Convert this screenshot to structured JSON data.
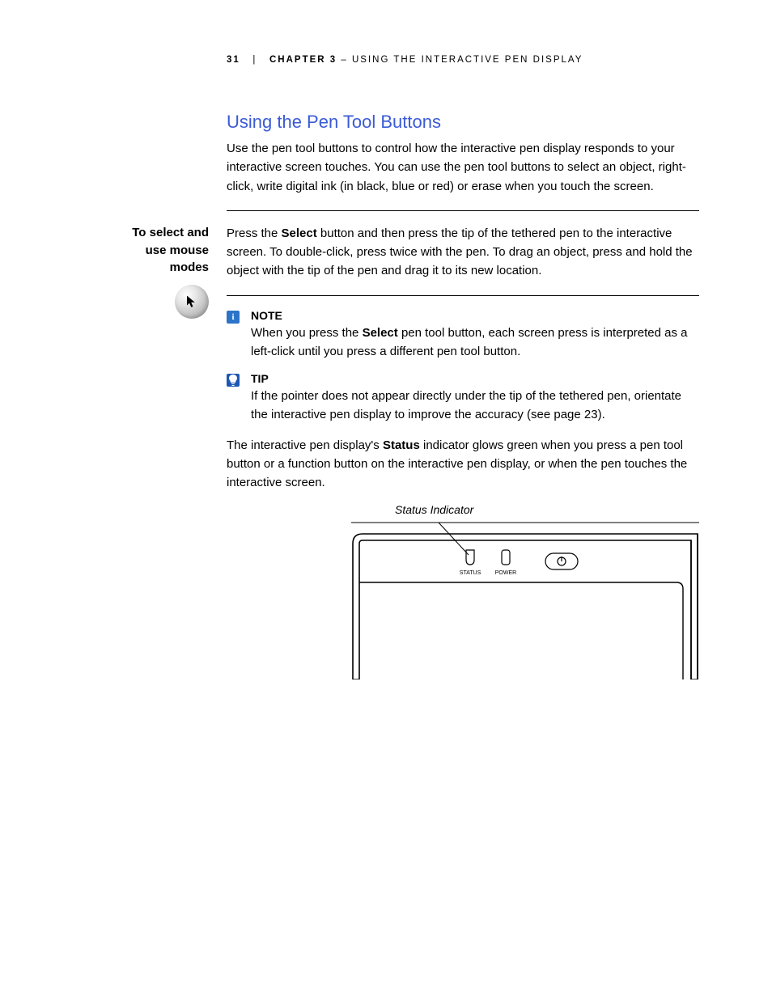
{
  "header": {
    "page_number": "31",
    "separator": "|",
    "chapter_label": "CHAPTER 3",
    "dash": " – ",
    "chapter_title": "USING THE INTERACTIVE PEN DISPLAY"
  },
  "section": {
    "title": "Using the Pen Tool Buttons",
    "intro": "Use the pen tool buttons to control how the interactive pen display responds to your interactive screen touches. You can use the pen tool buttons to select an object, right-click, write digital ink (in black, blue or red) or erase when you touch the screen."
  },
  "side_heading": "To select and use mouse modes",
  "select_para_pre": "Press the ",
  "select_bold": "Select",
  "select_para_post": " button and then press the tip of the tethered pen to the interactive screen. To double-click, press twice with the pen. To drag an object, press and hold the object with the tip of the pen and drag it to its new location.",
  "note": {
    "label": "NOTE",
    "body_pre": "When you press the ",
    "body_bold": "Select",
    "body_post": " pen tool button, each screen press is interpreted as a left-click until you press a different pen tool button."
  },
  "tip": {
    "label": "TIP",
    "body": "If the pointer does not appear directly under the tip of the tethered pen, orientate the interactive pen display to improve the accuracy (see page 23)."
  },
  "status_para_pre": "The interactive pen display's ",
  "status_bold": "Status",
  "status_para_post": " indicator glows green when you press a pen tool button or a function button on the interactive pen display, or when the pen touches the interactive screen.",
  "diagram": {
    "caption": "Status Indicator",
    "label_status": "STATUS",
    "label_power": "POWER"
  }
}
